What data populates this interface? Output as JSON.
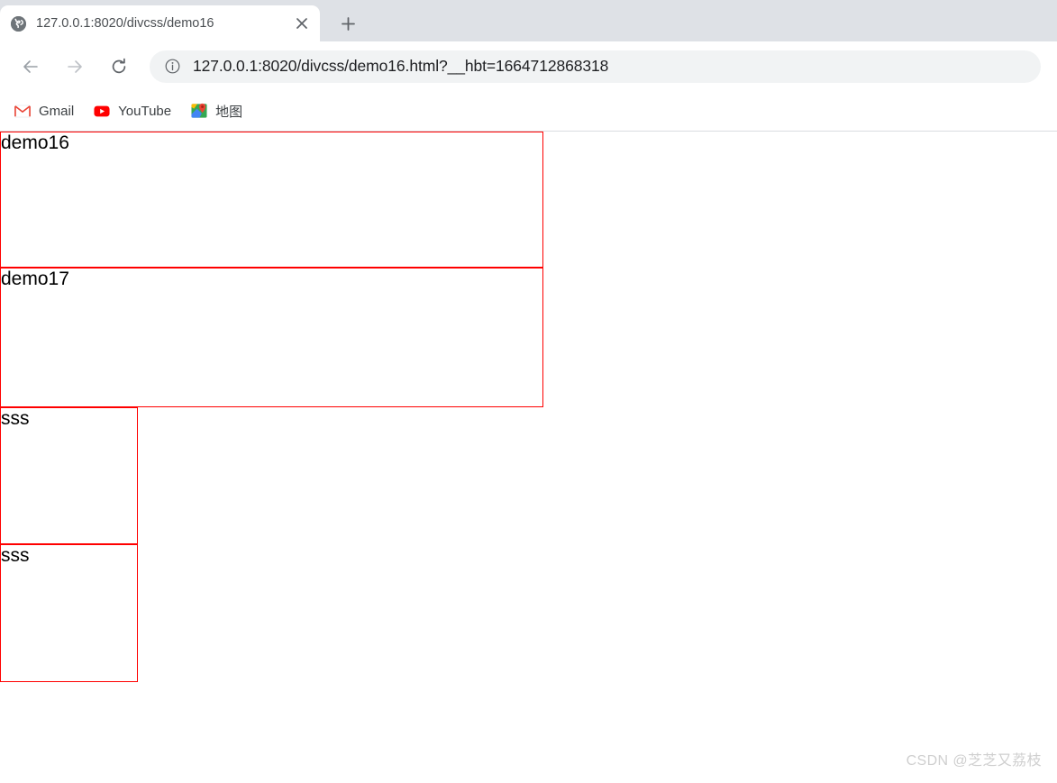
{
  "browser": {
    "tab": {
      "favicon": "globe-icon",
      "title": "127.0.0.1:8020/divcss/demo16",
      "close_label": "✕"
    },
    "new_tab_label": "+",
    "toolbar": {
      "back_label": "←",
      "forward_label": "→",
      "reload_label": "⟳",
      "security_icon": "info-circle-icon",
      "url": "127.0.0.1:8020/divcss/demo16.html?__hbt=1664712868318"
    },
    "bookmarks": [
      {
        "icon": "gmail-icon",
        "label": "Gmail"
      },
      {
        "icon": "youtube-icon",
        "label": "YouTube"
      },
      {
        "icon": "google-maps-icon",
        "label": "地图"
      }
    ]
  },
  "page": {
    "boxes": [
      {
        "text": "demo16"
      },
      {
        "text": "demo17"
      },
      {
        "text": "sss"
      },
      {
        "text": "sss"
      }
    ],
    "watermark": "CSDN @芝芝又荔枝",
    "border_color": "#ff0000"
  }
}
